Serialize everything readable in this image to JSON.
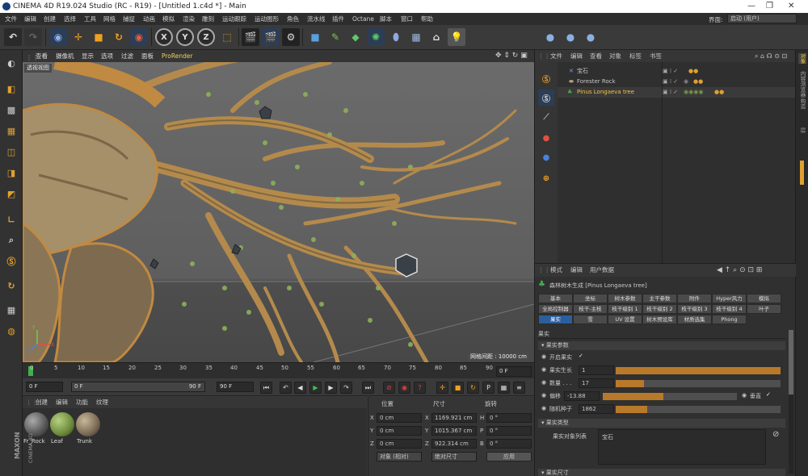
{
  "title": "CINEMA 4D R19.024 Studio (RC - R19) - [Untitled 1.c4d *] - Main",
  "menubar": {
    "items": [
      "文件",
      "编辑",
      "创建",
      "选择",
      "工具",
      "网格",
      "捕捉",
      "动画",
      "模拟",
      "渲染",
      "雕刻",
      "运动跟踪",
      "运动图形",
      "角色",
      "流水线",
      "插件",
      "Octane",
      "脚本",
      "窗口",
      "帮助"
    ],
    "interface_label": "界面:",
    "interface_value": "启动 (用户)"
  },
  "toolbar": {
    "axis_x": "X",
    "axis_y": "Y",
    "axis_z": "Z"
  },
  "viewport": {
    "menu": [
      "查看",
      "摄像机",
      "显示",
      "选项",
      "过滤",
      "面板",
      "ProRender"
    ],
    "label": "透视视图",
    "grid_label": "网格间距 : 10000 cm",
    "axis_labels": [
      "Y",
      "X",
      "Z"
    ]
  },
  "timeline": {
    "ticks": [
      "0",
      "5",
      "10",
      "15",
      "20",
      "25",
      "30",
      "35",
      "40",
      "45",
      "50",
      "55",
      "60",
      "65",
      "70",
      "75",
      "80",
      "85",
      "90"
    ],
    "end": "0 F"
  },
  "transport": {
    "start_frame": "0 F",
    "current_frame": "0 F",
    "range_end": "90 F",
    "end_frame": "90 F"
  },
  "materials": {
    "menu": [
      "创建",
      "编辑",
      "功能",
      "纹理"
    ],
    "items": [
      {
        "name": "Fr_Rock",
        "color": "#6b6b66"
      },
      {
        "name": "Leaf",
        "color": "#6d8a3b"
      },
      {
        "name": "Trunk",
        "color": "#7a6a55"
      }
    ],
    "brand1": "MAXON",
    "brand2": "CINEMA 4D"
  },
  "coords": {
    "headers": [
      "位置",
      "尺寸",
      "旋转"
    ],
    "rows": [
      {
        "axis": "X",
        "pos": "0 cm",
        "size_axis": "X",
        "size": "1169.921 cm",
        "rot_axis": "H",
        "rot": "0 °"
      },
      {
        "axis": "Y",
        "pos": "0 cm",
        "size_axis": "Y",
        "size": "1015.367 cm",
        "rot_axis": "P",
        "rot": "0 °"
      },
      {
        "axis": "Z",
        "pos": "0 cm",
        "size_axis": "Z",
        "size": "922.314 cm",
        "rot_axis": "B",
        "rot": "0 °"
      }
    ],
    "mode": "对象 (相对)",
    "size_mode": "绝对尺寸",
    "apply": "应用"
  },
  "objects": {
    "menu": [
      "文件",
      "编辑",
      "查看",
      "对象",
      "标签",
      "书签"
    ],
    "rows": [
      {
        "name": "宝石",
        "color": "#cfcfcf"
      },
      {
        "name": "Forester Rock",
        "color": "#cfcfcf"
      },
      {
        "name": "Pinus Longaeva tree",
        "color": "#f2c14e"
      }
    ]
  },
  "rightstrip": [
    "对象",
    "内容浏览器",
    "构造",
    "层"
  ],
  "attributes": {
    "menu": [
      "模式",
      "编辑",
      "用户数据"
    ],
    "object_title": "森林树木生成 [Pinus Longaeva tree]",
    "tabs_row1": [
      "基本",
      "坐标",
      "树木参数",
      "主干参数",
      "附件",
      "Hyper风力",
      "模拟"
    ],
    "tabs_row2": [
      "全局控制器",
      "枝干-主枝",
      "枝干级别 1",
      "枝干级别 2",
      "枝干级别 3",
      "枝干级别 4",
      "叶子"
    ],
    "tabs_row3": [
      "果实",
      "雪",
      "UV 设置",
      "树木预设库",
      "材质选集",
      "Phong"
    ],
    "active_tab": "果实",
    "section_label": "果实",
    "group1": "果实参数",
    "params": {
      "enable_label": "开启果实",
      "enable_check": "✓",
      "growth_label": "果实生长",
      "growth_value": "1",
      "count_label": "数量 . . .",
      "count_value": "17",
      "offset_label": "偏移",
      "offset_value": "-13.88",
      "vertical_label": "垂直",
      "vertical_check": "✓",
      "seed_label": "随机种子",
      "seed_value": "1862"
    },
    "group2": "果实类型",
    "list_label": "果实对象列表",
    "list_item": "宝石",
    "group3": "果实尺寸"
  }
}
